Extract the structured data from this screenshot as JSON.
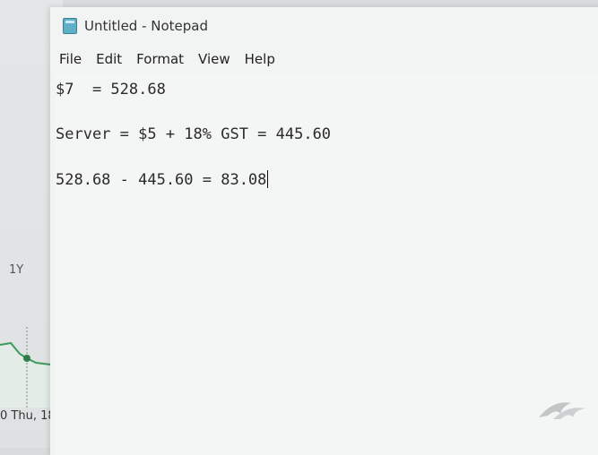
{
  "background_app": {
    "range_label": "1Y",
    "date_label": "0  Thu, 18"
  },
  "notepad": {
    "title": "Untitled - Notepad",
    "menu": [
      "File",
      "Edit",
      "Format",
      "View",
      "Help"
    ],
    "lines": [
      "$7  = 528.68",
      "Server = $5 + 18% GST = 445.60",
      "528.68 - 445.60 = 83.08"
    ]
  },
  "colors": {
    "chart_line": "#3c9a5f",
    "window_bg": "#f2f3f3"
  }
}
